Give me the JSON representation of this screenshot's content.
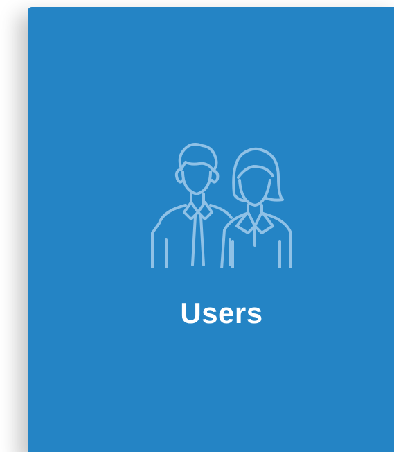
{
  "tile": {
    "label": "Users",
    "icon": "users-icon",
    "background_color": "#2484c5",
    "icon_color": "#8fc1e6",
    "text_color": "#ffffff"
  }
}
